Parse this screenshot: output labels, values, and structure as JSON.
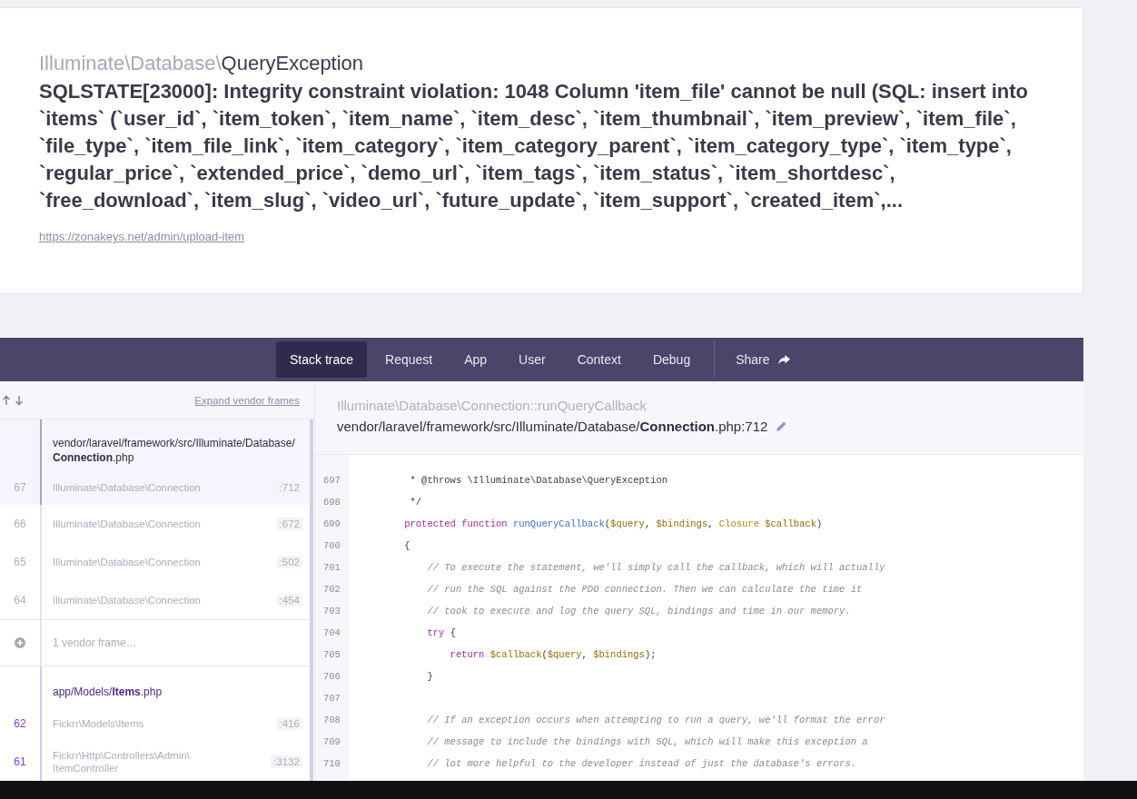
{
  "exception": {
    "class_prefix": "Illuminate\\Database\\",
    "class_name": "QueryException",
    "message": "SQLSTATE[23000]: Integrity constraint violation: 1048 Column 'item_file' cannot be null (SQL: insert into `items` (`user_id`, `item_token`, `item_name`, `item_desc`, `item_thumbnail`, `item_preview`, `item_file`, `file_type`, `item_file_link`, `item_category`, `item_category_parent`, `item_category_type`, `item_type`, `regular_price`, `extended_price`, `demo_url`, `item_tags`, `item_status`, `item_shortdesc`, `free_download`, `item_slug`, `video_url`, `future_update`, `item_support`, `created_item`,...",
    "url": "https://zonakeys.net/admin/upload-item"
  },
  "tabs": [
    {
      "label": "Stack trace",
      "selected": true
    },
    {
      "label": "Request",
      "selected": false
    },
    {
      "label": "App",
      "selected": false
    },
    {
      "label": "User",
      "selected": false
    },
    {
      "label": "Context",
      "selected": false
    },
    {
      "label": "Debug",
      "selected": false
    }
  ],
  "share": {
    "label": "Share"
  },
  "stack": {
    "expand_link": "Expand vendor frames",
    "items": [
      {
        "kind": "file",
        "vendor": true,
        "path": "vendor/laravel/framework/src/Illuminate/Database/**Connection**.php"
      },
      {
        "kind": "frame",
        "vendor": true,
        "number": "67",
        "class": "Illuminate\\Database\\Connection",
        "line": ":712",
        "selected": true
      },
      {
        "kind": "frame",
        "vendor": true,
        "number": "66",
        "class": "Illuminate\\Database\\Connection",
        "line": ":672",
        "selected": false
      },
      {
        "kind": "frame",
        "vendor": true,
        "number": "65",
        "class": "Illuminate\\Database\\Connection",
        "line": ":502",
        "selected": false
      },
      {
        "kind": "frame",
        "vendor": true,
        "number": "64",
        "class": "Illuminate\\Database\\Connection",
        "line": ":454",
        "selected": false
      },
      {
        "kind": "collapsed",
        "vendor": true,
        "label": "1 vendor frame…"
      },
      {
        "kind": "file",
        "vendor": false,
        "path": "app/Models/**Items**.php"
      },
      {
        "kind": "frame",
        "vendor": false,
        "number": "62",
        "class": "Fickrr\\Models\\Items",
        "line": ":416",
        "selected": false
      },
      {
        "kind": "frame",
        "vendor": false,
        "number": "61",
        "class": "Fickrr\\Http\\Controllers\\Admin\\ ItemController",
        "line": ":3132",
        "selected": false
      }
    ]
  },
  "frame_detail": {
    "method": "Illuminate\\Database\\Connection::runQueryCallback",
    "file": "vendor/laravel/framework/src/Illuminate/Database/**Connection**.php:712",
    "lines": [
      {
        "number": "697",
        "tokens": [
          {
            "kind": "plain",
            "text": "     * @throws \\Illuminate\\Database\\QueryException"
          }
        ]
      },
      {
        "number": "698",
        "tokens": [
          {
            "kind": "plain",
            "text": "     */"
          }
        ]
      },
      {
        "number": "699",
        "tokens": [
          {
            "kind": "keyword",
            "text": "    protected function "
          },
          {
            "kind": "function",
            "text": "runQueryCallback"
          },
          {
            "kind": "plain",
            "text": "("
          },
          {
            "kind": "variable",
            "text": "$query"
          },
          {
            "kind": "plain",
            "text": ", "
          },
          {
            "kind": "variable",
            "text": "$bindings"
          },
          {
            "kind": "plain",
            "text": ", "
          },
          {
            "kind": "type",
            "text": "Closure "
          },
          {
            "kind": "variable",
            "text": "$callback"
          },
          {
            "kind": "plain",
            "text": ")"
          }
        ]
      },
      {
        "number": "700",
        "tokens": [
          {
            "kind": "plain",
            "text": "    {"
          }
        ]
      },
      {
        "number": "701",
        "tokens": [
          {
            "kind": "comment",
            "text": "        // To execute the statement, we'll simply call the callback, which will actually"
          }
        ]
      },
      {
        "number": "702",
        "tokens": [
          {
            "kind": "comment",
            "text": "        // run the SQL against the PDO connection. Then we can calculate the time it"
          }
        ]
      },
      {
        "number": "703",
        "tokens": [
          {
            "kind": "comment",
            "text": "        // took to execute and log the query SQL, bindings and time in our memory."
          }
        ]
      },
      {
        "number": "704",
        "tokens": [
          {
            "kind": "keyword",
            "text": "        try "
          },
          {
            "kind": "plain",
            "text": "{"
          }
        ]
      },
      {
        "number": "705",
        "tokens": [
          {
            "kind": "keyword",
            "text": "            return "
          },
          {
            "kind": "variable",
            "text": "$callback"
          },
          {
            "kind": "plain",
            "text": "("
          },
          {
            "kind": "variable",
            "text": "$query"
          },
          {
            "kind": "plain",
            "text": ", "
          },
          {
            "kind": "variable",
            "text": "$bindings"
          },
          {
            "kind": "plain",
            "text": ");"
          }
        ]
      },
      {
        "number": "706",
        "tokens": [
          {
            "kind": "plain",
            "text": "        }"
          }
        ]
      },
      {
        "number": "707"
      },
      {
        "number": "708",
        "tokens": [
          {
            "kind": "comment",
            "text": "        // If an exception occurs when attempting to run a query, we'll format the error"
          }
        ]
      },
      {
        "number": "709",
        "tokens": [
          {
            "kind": "comment",
            "text": "        // message to include the bindings with SQL, which will make this exception a"
          }
        ]
      },
      {
        "number": "710",
        "tokens": [
          {
            "kind": "comment",
            "text": "        // lot more helpful to the developer instead of just the database's errors."
          }
        ]
      }
    ]
  }
}
